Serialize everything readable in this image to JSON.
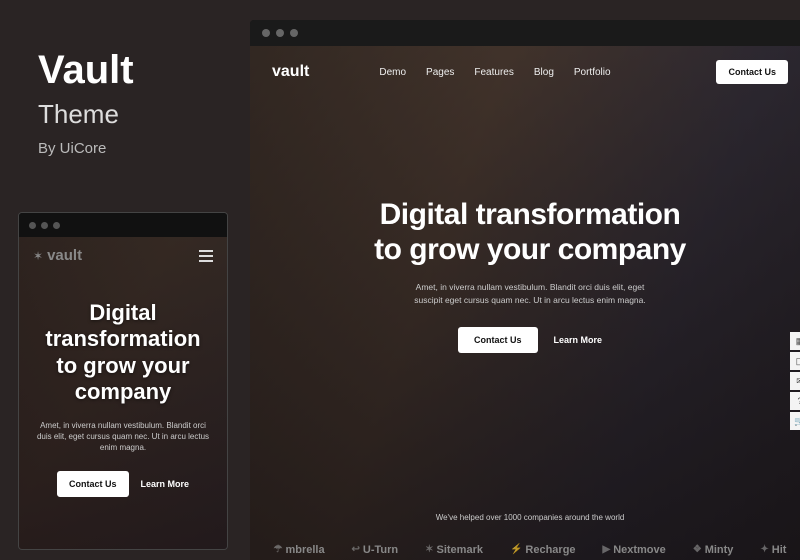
{
  "info": {
    "title": "Vault",
    "subtitle": "Theme",
    "author": "By UiCore"
  },
  "theme": {
    "logo": "vault",
    "nav": [
      "Demo",
      "Pages",
      "Features",
      "Blog",
      "Portfolio"
    ],
    "contact_label": "Contact Us",
    "hero_line1": "Digital transformation",
    "hero_line2": "to grow your company",
    "hero_sub1": "Amet, in viverra nullam vestibulum. Blandit orci duis elit, eget",
    "hero_sub2": "suscipit eget cursus quam nec. Ut in arcu lectus enim magna.",
    "cta_primary": "Contact Us",
    "cta_secondary": "Learn More",
    "helped_text": "We've helped over 1000 companies around the world",
    "client_logos": [
      "mbrella",
      "U-Turn",
      "Sitemark",
      "Recharge",
      "Nextmove",
      "Minty",
      "Hit"
    ]
  },
  "mobile": {
    "hero_line1": "Digital",
    "hero_line2": "transformation",
    "hero_line3": "to grow your",
    "hero_line4": "company",
    "sub1": "Amet, in viverra nullam vestibulum. Blandit orci",
    "sub2": "duis elit, eget cursus quam nec. Ut in arcu lectus",
    "sub3": "enim magna."
  },
  "side_tools": [
    "layout-icon",
    "panel-icon",
    "chat-icon",
    "help-icon",
    "cart-icon"
  ]
}
